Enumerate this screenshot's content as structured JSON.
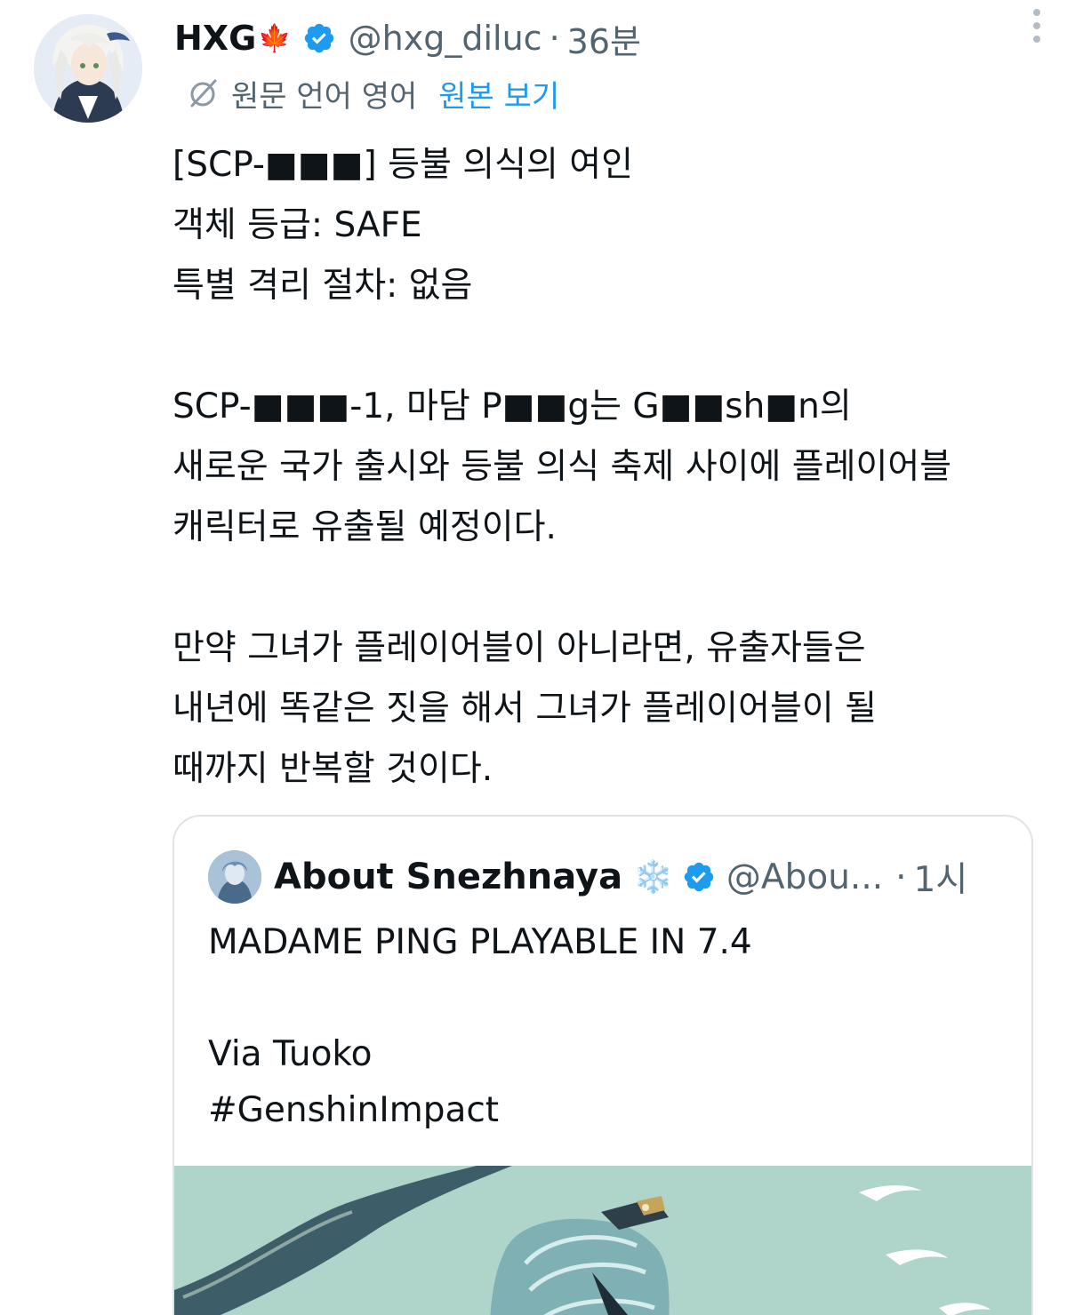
{
  "author": {
    "display_name": "HXG",
    "name_emoji": "🍁",
    "handle": "@hxg_diluc",
    "separator": "·",
    "time": "36분",
    "verified": true
  },
  "translation": {
    "label": "원문 언어 영어",
    "show_original": "원본 보기"
  },
  "tweet_lines": [
    "[SCP-■■■] 등불 의식의 여인",
    "객체 등급: SAFE",
    "특별 격리 절차: 없음",
    "",
    "SCP-■■■-1, 마담 P■■g는 G■■sh■n의",
    "새로운 국가 출시와 등불 의식 축제 사이에 플레이어블",
    "캐릭터로 유출될 예정이다.",
    "",
    "만약 그녀가 플레이어블이 아니라면, 유출자들은",
    "내년에 똑같은 짓을 해서 그녀가 플레이어블이 될",
    "때까지 반복할 것이다."
  ],
  "quoted": {
    "display_name": "About Snezhnaya",
    "name_emoji": "❄️",
    "handle": "@Abou...",
    "separator": "·",
    "time": "1시",
    "verified": true,
    "lines": [
      "MADAME PING PLAYABLE IN 7.4",
      "",
      "Via Tuoko",
      "#GenshinImpact"
    ]
  },
  "colors": {
    "accent": "#1d9bf0",
    "text": "#0f1419",
    "secondary": "#536471",
    "border": "#dfe4e8"
  },
  "icons": [
    "avatar",
    "verified-badge-icon",
    "more-options-icon",
    "translate-globe-icon",
    "snowflake-icon"
  ]
}
